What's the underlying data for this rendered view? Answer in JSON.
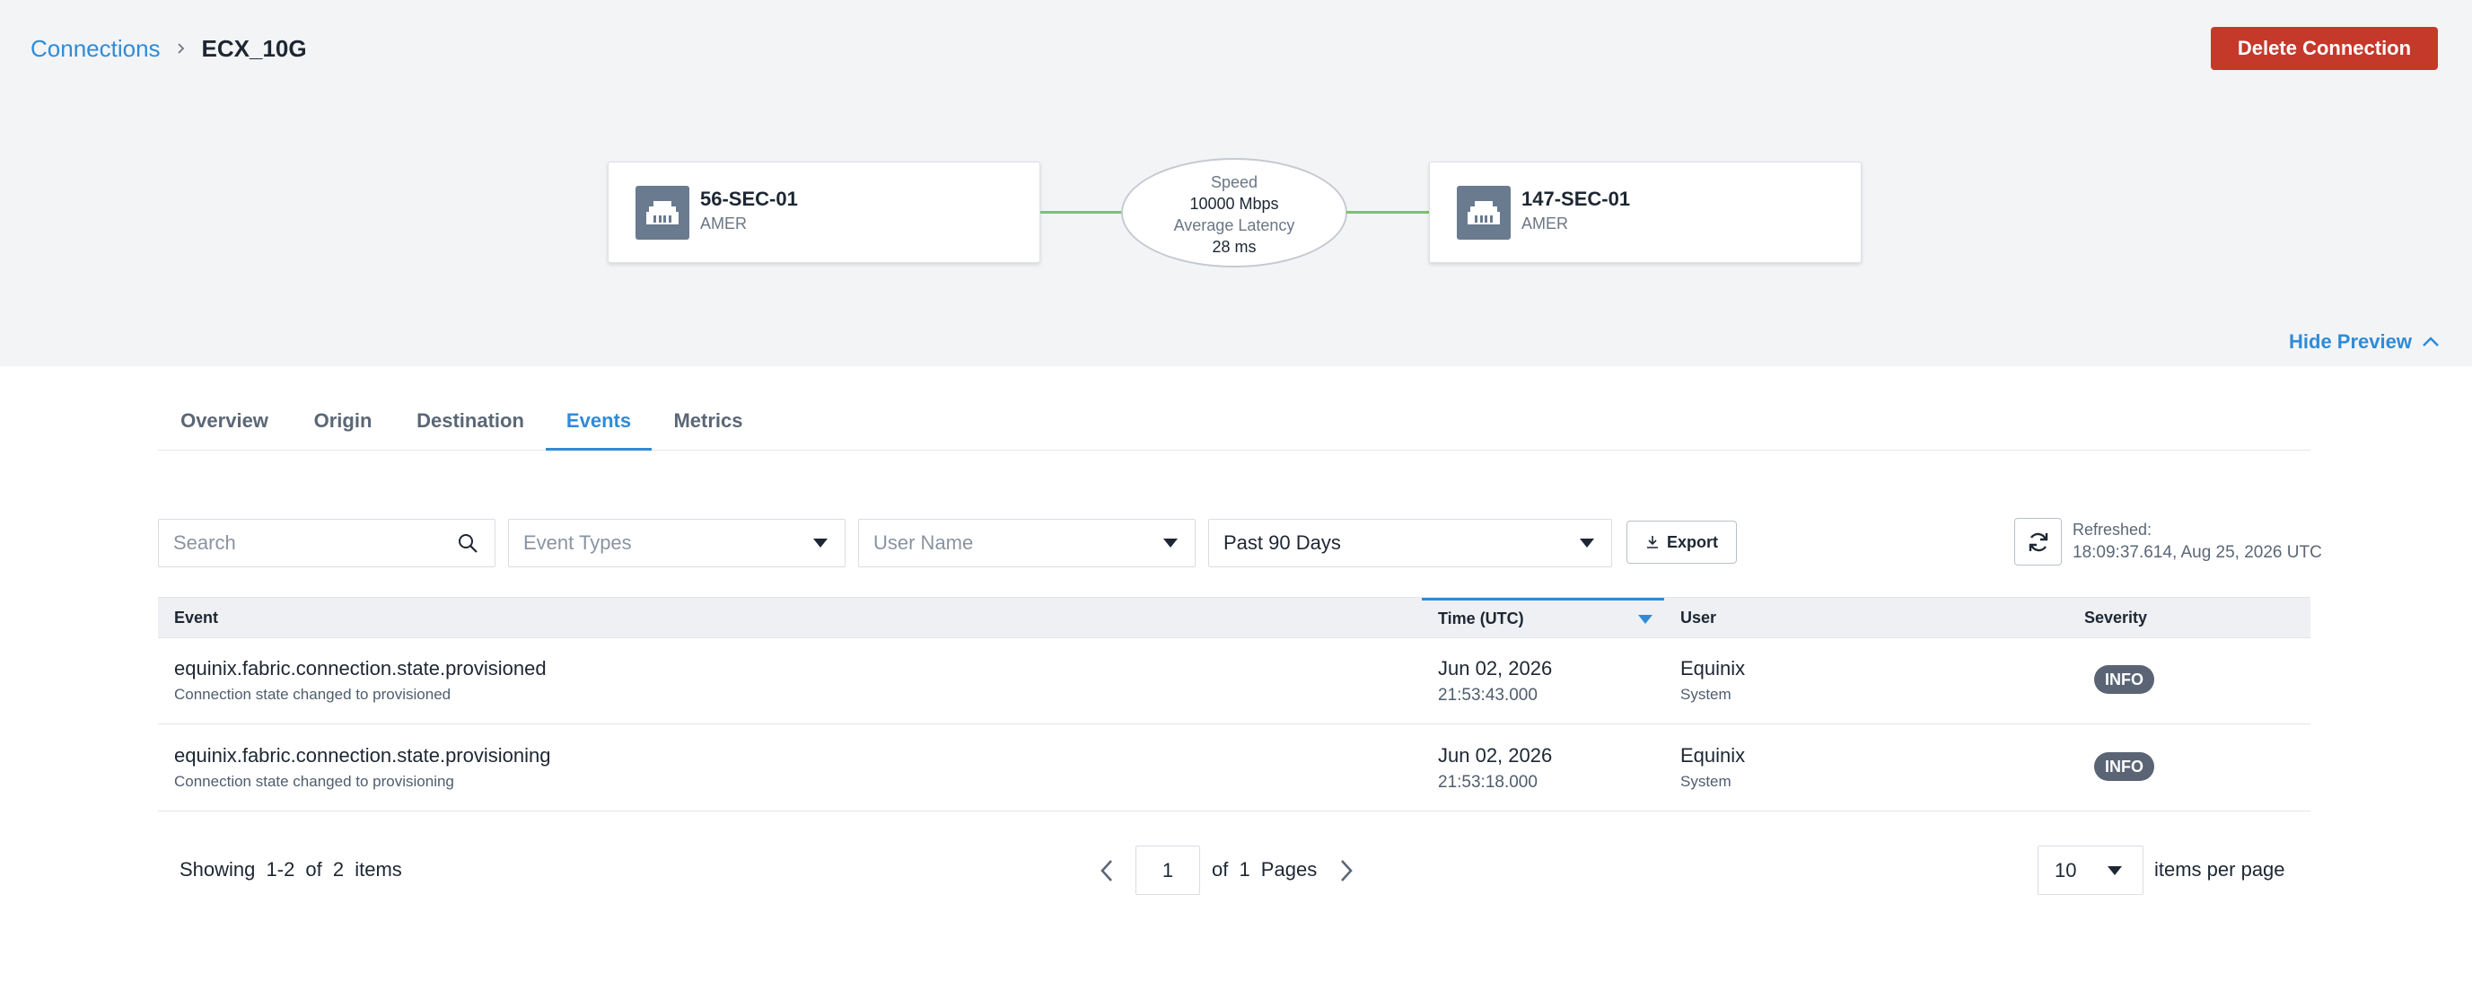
{
  "breadcrumb": {
    "parent": "Connections",
    "current": "ECX_10G"
  },
  "actions": {
    "delete_label": "Delete Connection"
  },
  "diagram": {
    "origin": {
      "name": "56-SEC-01",
      "region": "AMER"
    },
    "destination": {
      "name": "147-SEC-01",
      "region": "AMER"
    },
    "speed_label": "Speed",
    "speed_value": "10000 Mbps",
    "latency_label": "Average Latency",
    "latency_value": "28 ms"
  },
  "preview": {
    "toggle_label": "Hide Preview"
  },
  "tabs": [
    {
      "label": "Overview",
      "active": false
    },
    {
      "label": "Origin",
      "active": false
    },
    {
      "label": "Destination",
      "active": false
    },
    {
      "label": "Events",
      "active": true
    },
    {
      "label": "Metrics",
      "active": false
    }
  ],
  "filters": {
    "search_placeholder": "Search",
    "event_types_placeholder": "Event Types",
    "user_name_placeholder": "User Name",
    "date_range_value": "Past 90 Days",
    "export_label": "Export",
    "refreshed_label": "Refreshed:",
    "refreshed_time": "18:09:37.614, Aug 25, 2026 UTC"
  },
  "table": {
    "columns": [
      "Event",
      "Time (UTC)",
      "User",
      "Severity"
    ],
    "rows": [
      {
        "event": "equinix.fabric.connection.state.provisioned",
        "description": "Connection state changed to provisioned",
        "date": "Jun 02, 2026",
        "time": "21:53:43.000",
        "user": "Equinix",
        "user_type": "System",
        "severity": "INFO"
      },
      {
        "event": "equinix.fabric.connection.state.provisioning",
        "description": "Connection state changed to provisioning",
        "date": "Jun 02, 2026",
        "time": "21:53:18.000",
        "user": "Equinix",
        "user_type": "System",
        "severity": "INFO"
      }
    ]
  },
  "pagination": {
    "showing_text": "Showing 1-2 of 2 items",
    "current_page": "1",
    "pages_text": "of 1 Pages",
    "per_page_value": "10",
    "per_page_label": "items per page"
  },
  "colors": {
    "accent": "#2f8bd8",
    "danger": "#c5392a",
    "link_line": "#7cc36a",
    "badge": "#5a6474"
  }
}
